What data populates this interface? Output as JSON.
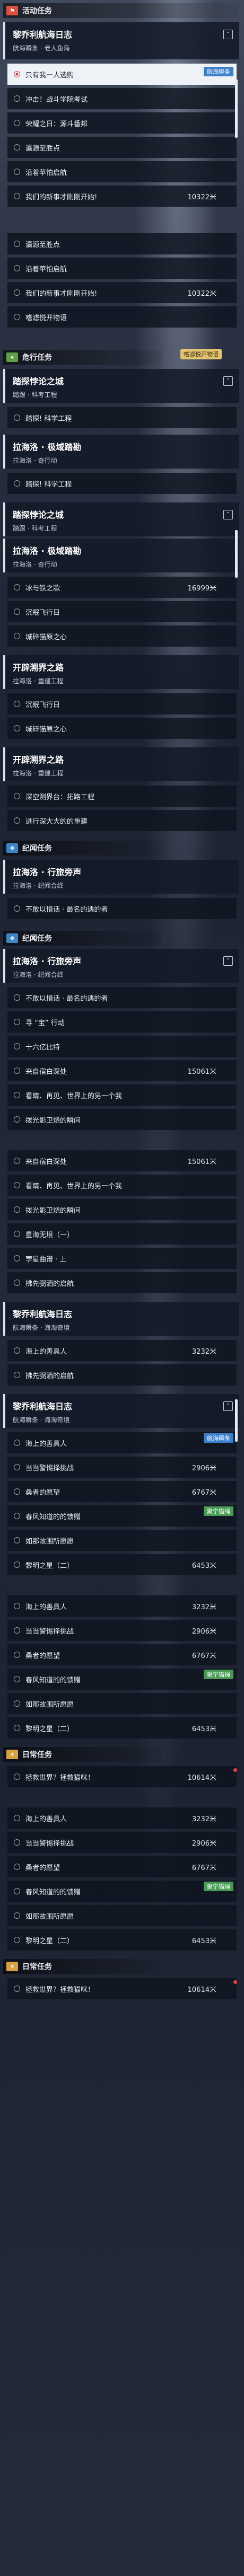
{
  "sections": {
    "activity": "活动任务",
    "danger": "危行任务",
    "tale": "纪闻任务",
    "daily": "日常任务"
  },
  "missions": {
    "journal_title": "黎乔利航海日志",
    "journal_sub1": "航海瞬条 · 老人鱼海",
    "journal_sub2": "航海瞬条 · 海淘奇境",
    "trial_title": "踏探悖论之城",
    "trial_sub": "踏跟 · 科考工程",
    "lahai_title": "拉海洛 · 极域踏勘",
    "lahai_sub": "拉海洛 · 奇行动",
    "lahai_sub2": "拉海洛 · 奇行合绎",
    "frontier_title": "开辟溯界之路",
    "frontier_sub": "拉海洛 · 重建工程",
    "wander_title": "拉海洛 · 行旅旁声",
    "wander_sub": "拉海洛 · 纪闻合绎"
  },
  "items": {
    "alone": "只有我一人选购",
    "sprint": "冲击！战斗学院考试",
    "honor": "荣耀之日：源斗番邦",
    "observe": "瀛源至胜点",
    "harbor": "沿着苹怕启航",
    "mine": "我们的新事才刚刚开始!",
    "return": "嗜滤悦开物语",
    "resume": "踏探!  科学工程",
    "ice": "冰与铁之歌",
    "eve": "沉眠飞行日",
    "heart": "城碎猫原之心",
    "deep": "深空测界台：拓路工程",
    "far": "进行深大大的的重建",
    "nofail": "不敢以惜话 · 最名的遇的者",
    "seek": "寻 “宝” 行动",
    "tenfold": "十六亿比特",
    "self": "来自宿白深处",
    "hear": "看睛、再见、世界上的另一个我",
    "light": "拨光影卫烧的瞬间",
    "stars": "星海无垠（一）",
    "tribe": "孛星曲谱 · 上",
    "kin": "拂先弼洒的启航",
    "sea": "海上的善具人",
    "duel": "当当警惕择挑战",
    "ride": "桑者的愿望",
    "spring": "春风知道的的馈赠",
    "brook": "如那故围所愿愿",
    "dawn": "黎明之星（二）",
    "world": "拯救世界？拯救猫咪！"
  },
  "values": {
    "v10322": "10322米",
    "v16999": "16999米",
    "v15061": "15061米",
    "v3232": "3232米",
    "v2906": "2906米",
    "v6767": "6767米",
    "v6453": "6453米",
    "v10614": "10614米"
  },
  "tags": {
    "sail": "航海瞬条",
    "follow": "聚宁猫绳"
  },
  "badge": "嗜滤悦开物语"
}
